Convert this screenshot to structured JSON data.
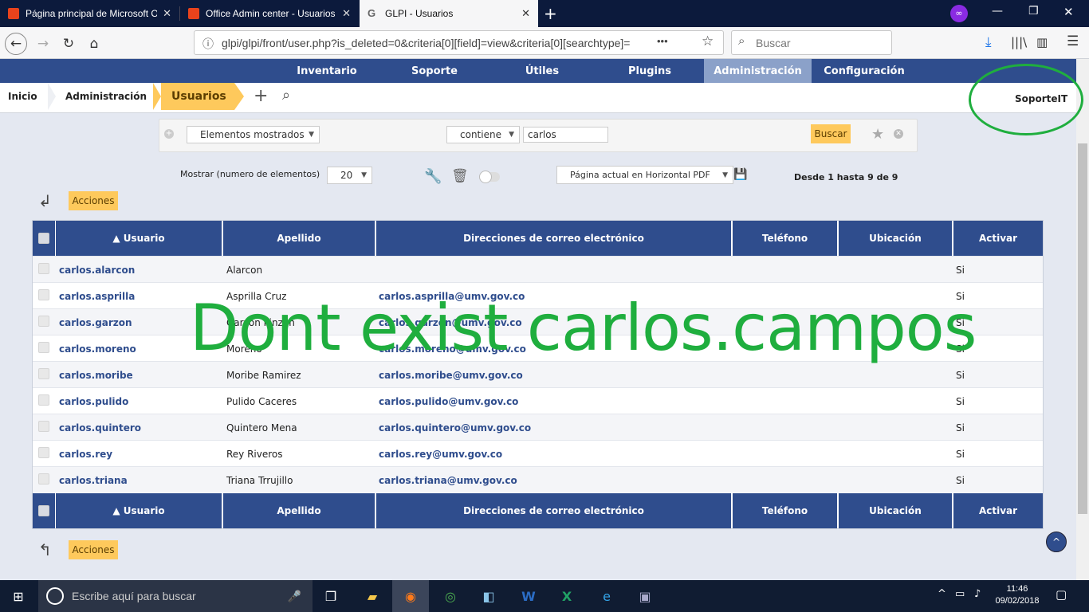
{
  "browser": {
    "tabs": [
      {
        "title": "Página principal de Microsoft Of",
        "active": false
      },
      {
        "title": "Office Admin center - Usuarios",
        "active": false
      },
      {
        "title": "GLPI - Usuarios",
        "active": true
      }
    ],
    "new_tab": "+",
    "url": "glpi/glpi/front/user.php?is_deleted=0&criteria[0][field]=view&criteria[0][searchtype]=",
    "url_more": "•••",
    "search_placeholder": "Buscar"
  },
  "menu": {
    "items": [
      "Inventario",
      "Soporte",
      "Útiles",
      "Plugins",
      "Administración",
      "Configuración"
    ],
    "active": "Administración"
  },
  "breadcrumb": {
    "items": [
      "Inicio",
      "Administración",
      "Usuarios"
    ]
  },
  "user": {
    "name": "SoporteIT"
  },
  "search": {
    "field": "Elementos mostrados",
    "operator": "contiene",
    "value": "carlos",
    "button": "Buscar"
  },
  "list": {
    "show_label": "Mostrar (numero de elementos)",
    "per_page": "20",
    "export_option": "Página actual en Horizontal PDF",
    "range": "Desde 1 hasta 9 de 9",
    "actions": "Acciones"
  },
  "table": {
    "columns": [
      "▲ Usuario",
      "Apellido",
      "Direcciones de correo electrónico",
      "Teléfono",
      "Ubicación",
      "Activar"
    ],
    "rows": [
      [
        "carlos.alarcon",
        "Alarcon",
        "",
        "",
        "",
        "Si"
      ],
      [
        "carlos.asprilla",
        "Asprilla Cruz",
        "carlos.asprilla@umv.gov.co",
        "",
        "",
        "Si"
      ],
      [
        "carlos.garzon",
        "Garzon Pinzon",
        "carlos.garzon@umv.gov.co",
        "",
        "",
        "Si"
      ],
      [
        "carlos.moreno",
        "Moreno",
        "carlos.moreno@umv.gov.co",
        "",
        "",
        "Si"
      ],
      [
        "carlos.moribe",
        "Moribe Ramirez",
        "carlos.moribe@umv.gov.co",
        "",
        "",
        "Si"
      ],
      [
        "carlos.pulido",
        "Pulido Caceres",
        "carlos.pulido@umv.gov.co",
        "",
        "",
        "Si"
      ],
      [
        "carlos.quintero",
        "Quintero Mena",
        "carlos.quintero@umv.gov.co",
        "",
        "",
        "Si"
      ],
      [
        "carlos.rey",
        "Rey Riveros",
        "carlos.rey@umv.gov.co",
        "",
        "",
        "Si"
      ],
      [
        "carlos.triana",
        "Triana Trrujillo",
        "carlos.triana@umv.gov.co",
        "",
        "",
        "Si"
      ]
    ]
  },
  "annotation": "Dont exist carlos.campos",
  "taskbar": {
    "search_placeholder": "Escribe aquí para buscar",
    "time": "11:46",
    "date": "09/02/2018"
  },
  "colors": {
    "menu": "#2f4d8d",
    "accent": "#fec95c",
    "annotation": "#1fae3e"
  }
}
